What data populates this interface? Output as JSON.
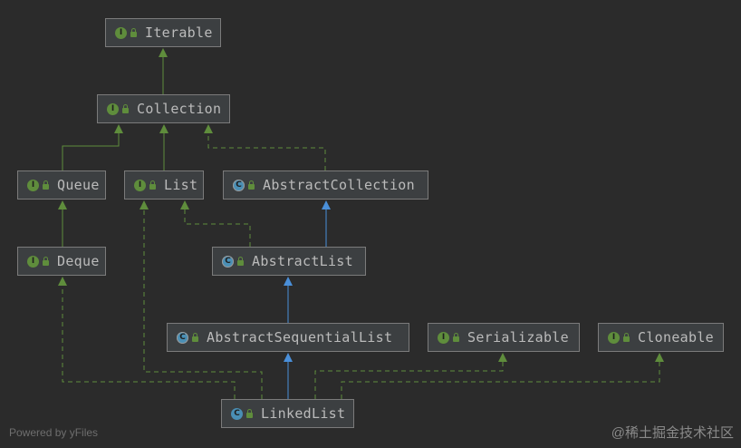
{
  "nodes": {
    "iterable": {
      "label": "Iterable",
      "kind": "interface",
      "badge": "I"
    },
    "collection": {
      "label": "Collection",
      "kind": "interface",
      "badge": "I"
    },
    "queue": {
      "label": "Queue",
      "kind": "interface",
      "badge": "I"
    },
    "list": {
      "label": "List",
      "kind": "interface",
      "badge": "I"
    },
    "abstract_collection": {
      "label": "AbstractCollection",
      "kind": "abstract",
      "badge": "C"
    },
    "deque": {
      "label": "Deque",
      "kind": "interface",
      "badge": "I"
    },
    "abstract_list": {
      "label": "AbstractList",
      "kind": "abstract",
      "badge": "C"
    },
    "abstract_sequential_list": {
      "label": "AbstractSequentialList",
      "kind": "abstract",
      "badge": "C"
    },
    "serializable": {
      "label": "Serializable",
      "kind": "interface",
      "badge": "I"
    },
    "cloneable": {
      "label": "Cloneable",
      "kind": "interface",
      "badge": "I"
    },
    "linked_list": {
      "label": "LinkedList",
      "kind": "class",
      "badge": "C"
    }
  },
  "edges": [
    {
      "from": "collection",
      "to": "iterable",
      "type": "extends"
    },
    {
      "from": "queue",
      "to": "collection",
      "type": "extends"
    },
    {
      "from": "list",
      "to": "collection",
      "type": "extends"
    },
    {
      "from": "abstract_collection",
      "to": "collection",
      "type": "implements"
    },
    {
      "from": "deque",
      "to": "queue",
      "type": "extends"
    },
    {
      "from": "abstract_list",
      "to": "abstract_collection",
      "type": "class-extends"
    },
    {
      "from": "abstract_list",
      "to": "list",
      "type": "implements"
    },
    {
      "from": "abstract_sequential_list",
      "to": "abstract_list",
      "type": "class-extends"
    },
    {
      "from": "linked_list",
      "to": "abstract_sequential_list",
      "type": "class-extends"
    },
    {
      "from": "linked_list",
      "to": "deque",
      "type": "implements"
    },
    {
      "from": "linked_list",
      "to": "list",
      "type": "implements"
    },
    {
      "from": "linked_list",
      "to": "serializable",
      "type": "implements"
    },
    {
      "from": "linked_list",
      "to": "cloneable",
      "type": "implements"
    }
  ],
  "colors": {
    "background": "#2b2b2b",
    "extends_edge": "#5f8d3c",
    "class_extends_edge": "#4a8fd9",
    "interface_badge": "#5f8d3c",
    "class_badge": "#4a8fb5"
  },
  "footer": {
    "powered_by": "Powered by yFiles"
  },
  "watermark": {
    "text": "@稀土掘金技术社区"
  }
}
